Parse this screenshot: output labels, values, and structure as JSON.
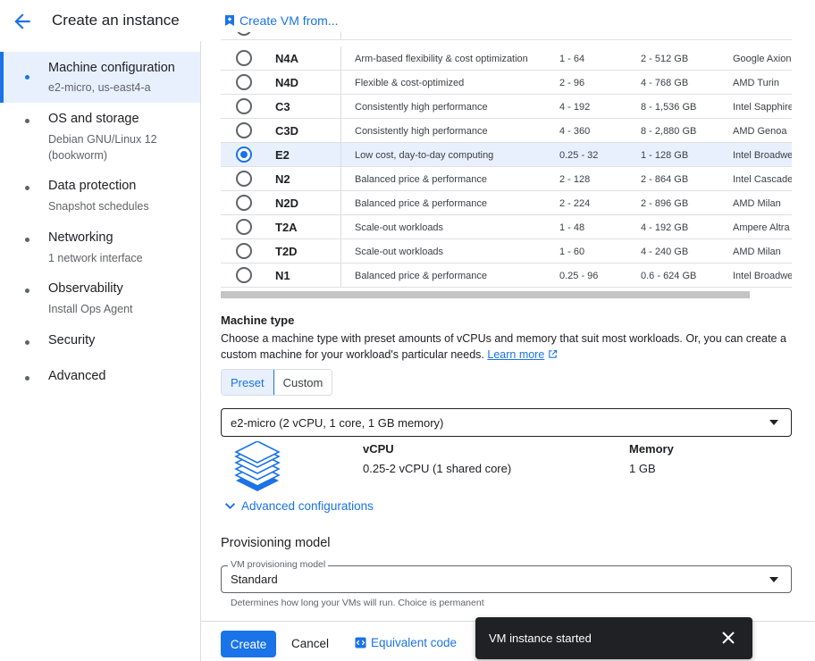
{
  "header": {
    "title": "Create an instance",
    "create_from_label": "Create VM from..."
  },
  "sidebar": {
    "items": [
      {
        "title": "Machine configuration",
        "subtitle": "e2-micro, us-east4-a",
        "active": true
      },
      {
        "title": "OS and storage",
        "subtitle": "Debian GNU/Linux 12\n(bookworm)",
        "active": false
      },
      {
        "title": "Data protection",
        "subtitle": "Snapshot schedules",
        "active": false
      },
      {
        "title": "Networking",
        "subtitle": "1 network interface",
        "active": false
      },
      {
        "title": "Observability",
        "subtitle": "Install Ops Agent",
        "active": false
      },
      {
        "title": "Security",
        "subtitle": "",
        "active": false
      },
      {
        "title": "Advanced",
        "subtitle": "",
        "active": false
      }
    ]
  },
  "machine_series": {
    "selected": "E2",
    "rows": [
      {
        "series": "N4A",
        "description": "Arm-based flexibility & cost optimization",
        "vcpus": "1 - 64",
        "memory": "2 - 512 GB",
        "platform": "Google Axion"
      },
      {
        "series": "N4D",
        "description": "Flexible & cost-optimized",
        "vcpus": "2 - 96",
        "memory": "4 - 768 GB",
        "platform": "AMD Turin"
      },
      {
        "series": "C3",
        "description": "Consistently high performance",
        "vcpus": "4 - 192",
        "memory": "8 - 1,536 GB",
        "platform": "Intel Sapphire"
      },
      {
        "series": "C3D",
        "description": "Consistently high performance",
        "vcpus": "4 - 360",
        "memory": "8 - 2,880 GB",
        "platform": "AMD Genoa"
      },
      {
        "series": "E2",
        "description": "Low cost, day-to-day computing",
        "vcpus": "0.25 - 32",
        "memory": "1 - 128 GB",
        "platform": "Intel Broadwe"
      },
      {
        "series": "N2",
        "description": "Balanced price & performance",
        "vcpus": "2 - 128",
        "memory": "2 - 864 GB",
        "platform": "Intel Cascade"
      },
      {
        "series": "N2D",
        "description": "Balanced price & performance",
        "vcpus": "2 - 224",
        "memory": "2 - 896 GB",
        "platform": "AMD Milan"
      },
      {
        "series": "T2A",
        "description": "Scale-out workloads",
        "vcpus": "1 - 48",
        "memory": "4 - 192 GB",
        "platform": "Ampere Altra"
      },
      {
        "series": "T2D",
        "description": "Scale-out workloads",
        "vcpus": "1 - 60",
        "memory": "4 - 240 GB",
        "platform": "AMD Milan"
      },
      {
        "series": "N1",
        "description": "Balanced price & performance",
        "vcpus": "0.25 - 96",
        "memory": "0.6 - 624 GB",
        "platform": "Intel Broadwe"
      }
    ]
  },
  "machine_type": {
    "heading": "Machine type",
    "description": "Choose a machine type with preset amounts of vCPUs and memory that suit most workloads. Or, you can create a custom machine for your workload's particular needs.",
    "learn_more": "Learn more",
    "segments": [
      "Preset",
      "Custom"
    ],
    "selected_segment": "Preset",
    "selected_value": "e2-micro (2 vCPU, 1 core, 1 GB memory)",
    "vcpu_label": "vCPU",
    "vcpu_value": "0.25-2 vCPU (1 shared core)",
    "memory_label": "Memory",
    "memory_value": "1 GB",
    "advanced_link": "Advanced configurations"
  },
  "provisioning": {
    "heading": "Provisioning model",
    "field_label": "VM provisioning model",
    "value": "Standard",
    "help": "Determines how long your VMs will run. Choice is permanent"
  },
  "footer": {
    "create": "Create",
    "cancel": "Cancel",
    "equivalent_code": "Equivalent code"
  },
  "toast": {
    "message": "VM instance started"
  },
  "colors": {
    "accent": "#1a73e8",
    "selected_bg": "#e8f0fe",
    "toast_bg": "#202124"
  }
}
